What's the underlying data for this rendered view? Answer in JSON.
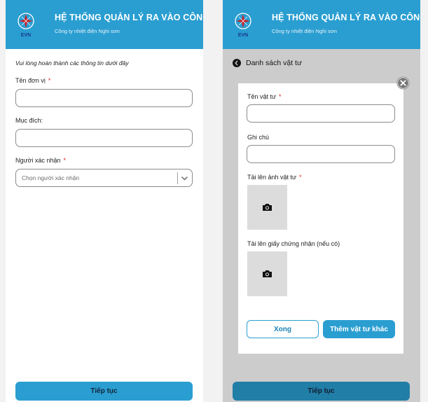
{
  "colors": {
    "brand": "#2a9ed1",
    "required": "#e02424",
    "overlay_dim": "#c8c8c8"
  },
  "header": {
    "title": "HỆ THỐNG QUẢN LÝ RA VÀO CÔNG TY",
    "subtitle": "Công ty nhiệt điện Nghi sơn",
    "logo_text": "EVN"
  },
  "form": {
    "instruction": "Vui lòng hoàn thành các thông tin dưới đây",
    "unit_label": "Tên đơn vị",
    "unit_value": "",
    "purpose_label": "Mục đích:",
    "purpose_value": "",
    "approver_label": "Người xác nhận",
    "approver_placeholder": "Chọn người xác nhận",
    "required_mark": "*",
    "submit_label": "Tiếp tục"
  },
  "materials": {
    "back_label": "Danh sách vật tư",
    "name_label": "Tên vật tư",
    "name_value": "",
    "note_label": "Ghi chú",
    "note_value": "",
    "photo_label": "Tải lên ảnh vật tư",
    "certificate_label": "Tải lên giấy chứng nhận (nếu có)",
    "done_label": "Xong",
    "add_more_label": "Thêm vật tư khác",
    "required_mark": "*",
    "submit_label": "Tiếp tục"
  }
}
